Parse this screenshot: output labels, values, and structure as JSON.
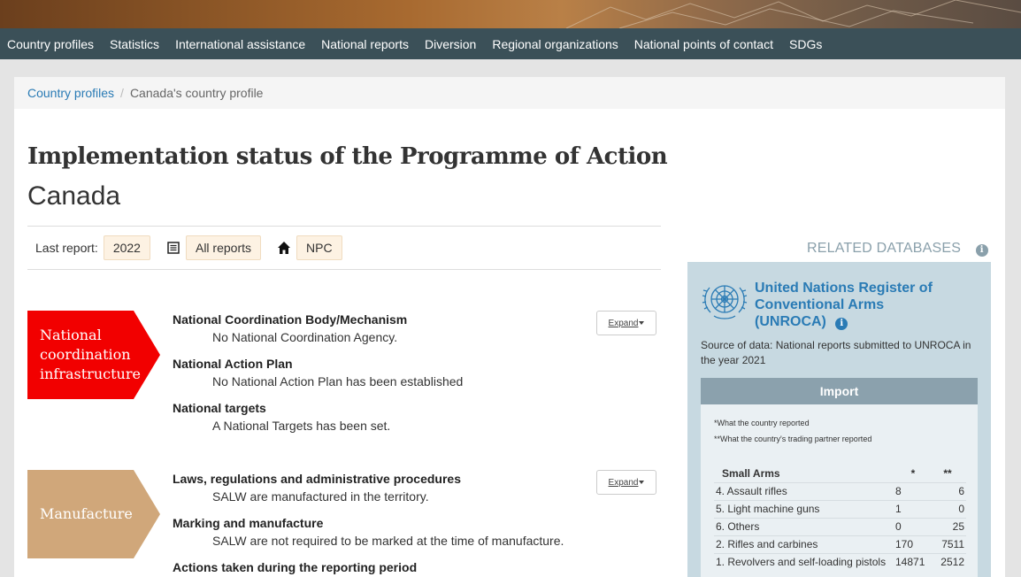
{
  "nav": {
    "items": [
      "Country profiles",
      "Statistics",
      "International assistance",
      "National reports",
      "Diversion",
      "Regional organizations",
      "National points of contact",
      "SDGs"
    ]
  },
  "breadcrumb": {
    "home": "Country profiles",
    "current": "Canada's country profile"
  },
  "page": {
    "title": "Implementation status of the Programme of Action",
    "country": "Canada"
  },
  "report_bar": {
    "last_report_label": "Last report:",
    "year": "2022",
    "all_reports": "All reports",
    "npc": "NPC"
  },
  "sections": [
    {
      "tag": "National coordination infrastructure",
      "color": "#f20000",
      "expand_label": "Expand",
      "items": [
        {
          "heading": "National Coordination Body/Mechanism",
          "detail": "No National Coordination Agency."
        },
        {
          "heading": "National Action Plan",
          "detail": "No National Action Plan has been established"
        },
        {
          "heading": "National targets",
          "detail": "A National Targets has been set."
        }
      ]
    },
    {
      "tag": "Manufacture",
      "color": "#d0a77a",
      "expand_label": "Expand",
      "items": [
        {
          "heading": "Laws, regulations and administrative procedures",
          "detail": "SALW are manufactured in the territory."
        },
        {
          "heading": "Marking and manufacture",
          "detail": "SALW are not required to be marked at the time of manufacture."
        },
        {
          "heading": "Actions taken during the reporting period",
          "detail": ""
        }
      ]
    }
  ],
  "sidebar": {
    "related_title": "RELATED DATABASES",
    "unroca_name": "United Nations Register of Conventional Arms (UNROCA)",
    "source": "Source of data: National reports submitted to UNROCA in the year 2021",
    "import_title": "Import",
    "note1_mark": "*",
    "note1": "What the country reported",
    "note2_mark": "**",
    "note2": "What the country's trading partner reported",
    "table_headers": [
      "Small Arms",
      "*",
      "**"
    ],
    "rows": [
      [
        "4. Assault rifles",
        "8",
        "6"
      ],
      [
        "5. Light machine guns",
        "1",
        "0"
      ],
      [
        "6. Others",
        "0",
        "25"
      ],
      [
        "2. Rifles and carbines",
        "170",
        "7511"
      ],
      [
        "1. Revolvers and self-loading pistols",
        "14871",
        "2512"
      ]
    ]
  }
}
